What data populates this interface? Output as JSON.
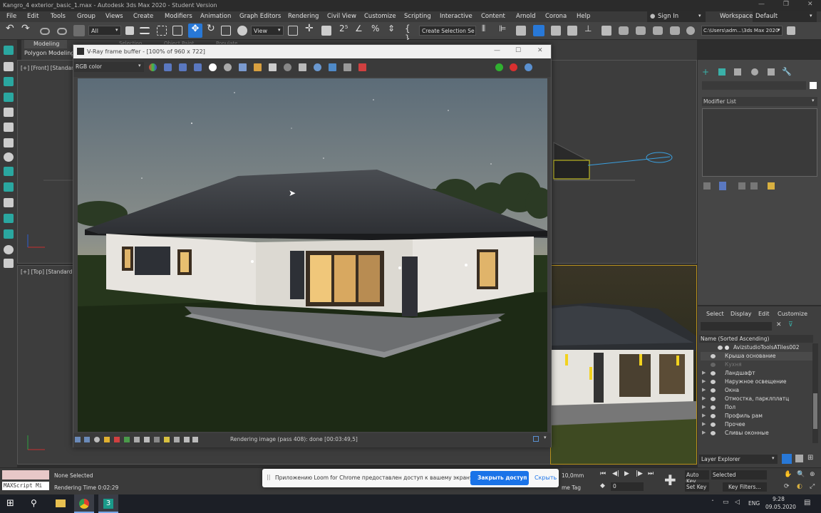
{
  "window": {
    "title": "Kangro_4 exterior_basic_1.max - Autodesk 3ds Max 2020 - Student Version"
  },
  "menu": [
    "File",
    "Edit",
    "Tools",
    "Group",
    "Views",
    "Create",
    "Modifiers",
    "Animation",
    "Graph Editors",
    "Rendering",
    "Civil View",
    "Customize",
    "Scripting",
    "Interactive",
    "Content",
    "Arnold",
    "Corona",
    "Help"
  ],
  "account": {
    "sign_in": "Sign In",
    "workspaces_label": "Workspaces:",
    "workspace": "Default"
  },
  "toolbar": {
    "selection_filter": "All",
    "ref_coord": "View",
    "selection_set": "Create Selection Se",
    "project_path": "C:\\Users\\adm...\\3ds Max 2020"
  },
  "ribbon": {
    "tab": "Modeling",
    "sub": "Polygon Modeling",
    "hidden_tabs": [
      "Selection",
      "Object Paint",
      "Populate"
    ]
  },
  "viewports": {
    "front": "[+] [Front] [Standard]",
    "top": "[+] [Top] [Standard]"
  },
  "vfb": {
    "title": "V-Ray frame buffer - [100% of 960 x 722]",
    "channel": "RGB color",
    "status": "Rendering image (pass 408): done [00:03:49,5]"
  },
  "cmdpanel": {
    "modifier_list": "Modifier List"
  },
  "scene_explorer": {
    "tabs": [
      "Select",
      "Display",
      "Edit",
      "Customize"
    ],
    "column": "Name (Sorted Ascending)",
    "rows": [
      "AvizstudioToolsATiles002",
      "Крыша основание",
      "Кухня",
      "Ландшафт",
      "Наружное освещение",
      "Окна",
      "Отмостка, парклплатц",
      "Пол",
      "Профиль рам",
      "Прочее",
      "Сливы оконные"
    ],
    "footer": "Layer Explorer"
  },
  "status": {
    "maxscript": "MAXScript Mi",
    "selection": "None Selected",
    "render_time": "Rendering Time  0:02:29",
    "grid": "10,0mm",
    "time_tag": "me Tag",
    "frame": "0",
    "auto_key": "Auto Key",
    "set_key": "Set Key",
    "key_mode": "Selected",
    "key_filters": "Key Filters..."
  },
  "loom": {
    "message": "Приложению Loom for Chrome предоставлен доступ к вашему экрану.",
    "stop": "Закрыть доступ",
    "hide": "Скрыть"
  },
  "taskbar": {
    "lang": "ENG",
    "time": "9:28",
    "date": "09.05.2020"
  },
  "colors": {
    "accent": "#2878d7",
    "vfb_bg": "#404040",
    "ui_bg": "#444444"
  }
}
